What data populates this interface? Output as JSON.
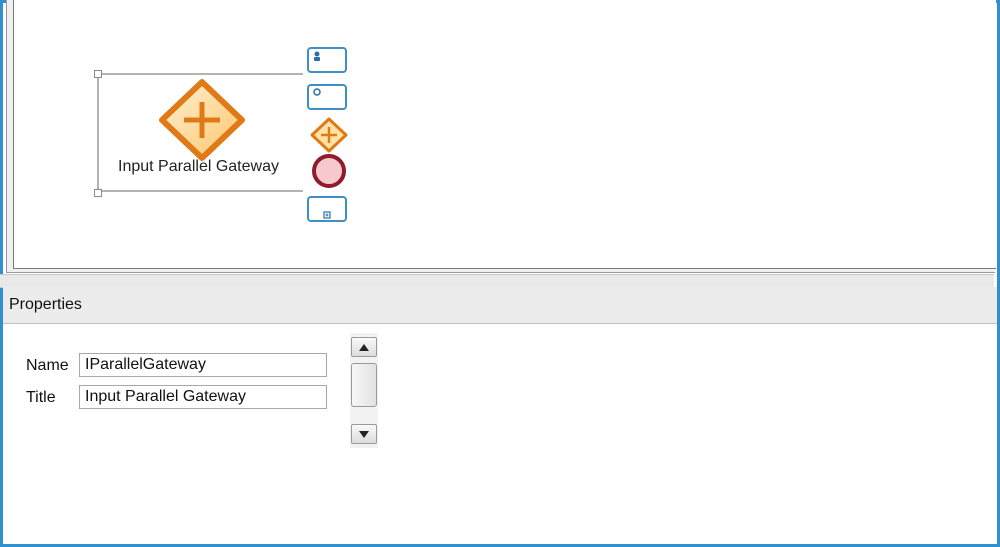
{
  "canvas": {
    "selected_element": {
      "type_icon": "parallel-gateway-icon",
      "label": "Input Parallel Gateway"
    },
    "palette": [
      {
        "icon": "user-task-icon"
      },
      {
        "icon": "timer-event-icon"
      },
      {
        "icon": "parallel-gateway-icon"
      },
      {
        "icon": "end-event-icon"
      },
      {
        "icon": "subprocess-icon"
      }
    ],
    "colors": {
      "gateway_fill": "#fcd68a",
      "gateway_stroke": "#e07a17",
      "end_event_fill": "#f8c8cf",
      "end_event_stroke": "#8e1c2a",
      "palette_border": "#3f8ec5"
    }
  },
  "properties": {
    "title": "Properties",
    "fields": [
      {
        "label": "Name",
        "value": "IParallelGateway"
      },
      {
        "label": "Title",
        "value": "Input Parallel Gateway"
      }
    ],
    "scrollbar": {
      "up_icon": "arrow-up-icon",
      "down_icon": "arrow-down-icon"
    }
  }
}
